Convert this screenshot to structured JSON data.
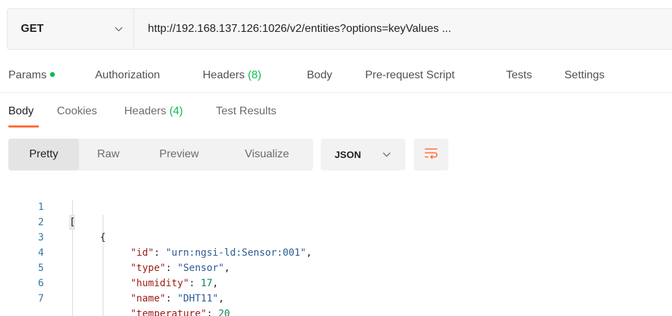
{
  "request": {
    "method": "GET",
    "url": "http://192.168.137.126:1026/v2/entities?options=keyValues ..."
  },
  "request_tabs": {
    "params": "Params",
    "authorization": "Authorization",
    "headers": "Headers",
    "headers_count": "(8)",
    "body": "Body",
    "pre_request_script": "Pre-request Script",
    "tests": "Tests",
    "settings": "Settings"
  },
  "response_tabs": {
    "body": "Body",
    "cookies": "Cookies",
    "headers": "Headers",
    "headers_count": "(4)",
    "test_results": "Test Results"
  },
  "view": {
    "pretty": "Pretty",
    "raw": "Raw",
    "preview": "Preview",
    "visualize": "Visualize",
    "format": "JSON",
    "wrap_icon": "wrap-lines-icon"
  },
  "code": {
    "line_numbers": [
      "1",
      "2",
      "3",
      "4",
      "5",
      "6",
      "7"
    ],
    "open_bracket": "[",
    "open_brace": "{",
    "lines": [
      {
        "key": "\"id\"",
        "value": "\"urn:ngsi-ld:Sensor:001\"",
        "comma": ","
      },
      {
        "key": "\"type\"",
        "value": "\"Sensor\"",
        "comma": ","
      },
      {
        "key": "\"humidity\"",
        "value": "17",
        "comma": ","
      },
      {
        "key": "\"name\"",
        "value": "\"DHT11\"",
        "comma": ","
      },
      {
        "key": "\"temperature\"",
        "value": "20",
        "comma": ""
      }
    ],
    "colon": ": "
  },
  "colors": {
    "accent": "#ff6c37",
    "green": "#0cbb52",
    "key": "#9c1b16",
    "string": "#2c5a94",
    "number": "#108353"
  }
}
